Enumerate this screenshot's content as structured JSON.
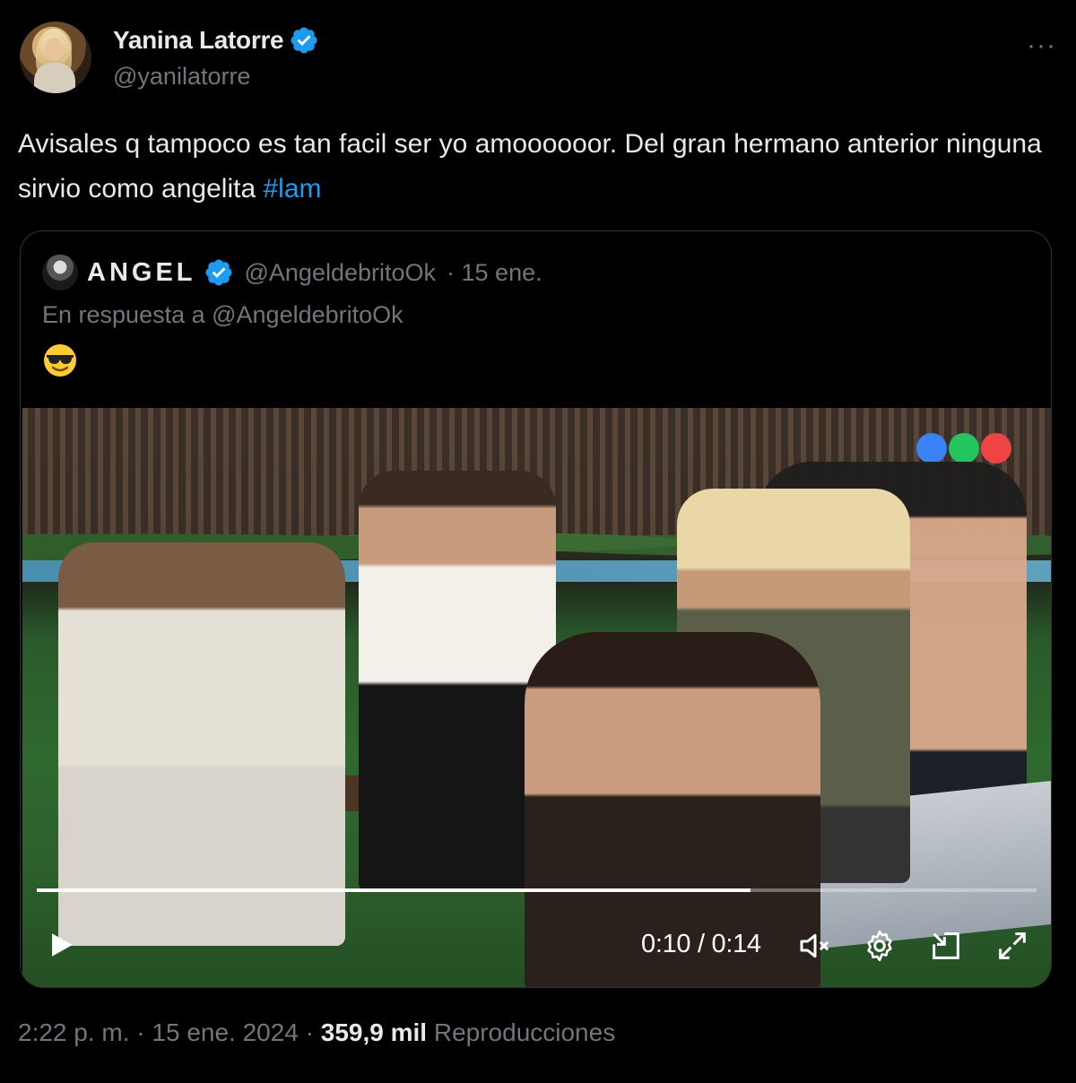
{
  "author": {
    "name": "Yanina Latorre",
    "handle": "@yanilatorre",
    "verified_icon": "verified-badge-icon",
    "more_icon": "more-options-icon",
    "more_label": "···"
  },
  "tweet": {
    "text": "Avisales q tampoco es tan facil ser yo amoooooor. Del gran hermano anterior ninguna sirvio como angelita ",
    "hashtag": "#lam"
  },
  "quote": {
    "name": "ANGEL",
    "handle": "@AngeldebritoOk",
    "date": "· 15 ene.",
    "reply_to": "En respuesta a @AngeldebritoOk",
    "emoji_icon": "sunglasses-emoji-icon",
    "video": {
      "time": "0:10 / 0:14",
      "progress_fraction": 0.714,
      "controls": [
        "play-icon",
        "mute-icon",
        "settings-icon",
        "pip-icon",
        "fullscreen-icon"
      ]
    }
  },
  "footer": {
    "time_date": "2:22 p. m. · 15 ene. 2024 · ",
    "views_count": "359,9 mil",
    "views_label": " Reproducciones"
  },
  "colors": {
    "background": "#000000",
    "text": "#e7e9ea",
    "muted": "#71767b",
    "accent": "#1d9bf0",
    "border": "#2f3336"
  }
}
